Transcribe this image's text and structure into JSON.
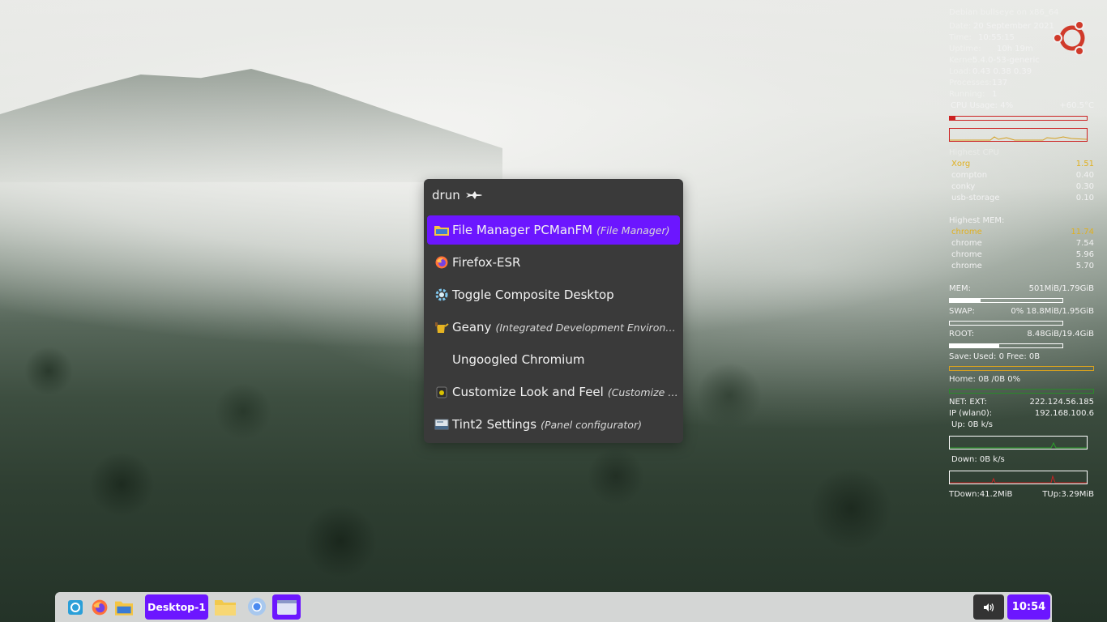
{
  "conky": {
    "header": "Debian bullseye on x86_64",
    "sys": [
      {
        "label": "Date:",
        "value": "20 September 2021"
      },
      {
        "label": "Time:",
        "value": "10:55:15"
      },
      {
        "label": "Uptime:",
        "value": "10h 19m"
      },
      {
        "label": "Kernel:",
        "value": "5.4.0-53-generic"
      },
      {
        "label": "Load:",
        "value": "0.43 0.38 0.39"
      },
      {
        "label": "Processes:",
        "value": "137"
      },
      {
        "label": "Running:",
        "value": "1"
      }
    ],
    "cpu": {
      "label": "CPU Usage: 4%",
      "temp": "+60.5°C",
      "usage": 0.04
    },
    "highest_cpu": {
      "title": "Highest CPU",
      "rows": [
        {
          "name": "Xorg",
          "value": "1.51"
        },
        {
          "name": "compton",
          "value": "0.40"
        },
        {
          "name": "conky",
          "value": "0.30"
        },
        {
          "name": "usb-storage",
          "value": "0.10"
        }
      ]
    },
    "highest_mem": {
      "title": "Highest MEM:",
      "rows": [
        {
          "name": "chrome",
          "value": "11.74"
        },
        {
          "name": "chrome",
          "value": "7.54"
        },
        {
          "name": "chrome",
          "value": "5.96"
        },
        {
          "name": "chrome",
          "value": "5.70"
        }
      ]
    },
    "mem": {
      "label": "MEM:",
      "value": "501MiB/1.79GiB",
      "fill": 0.27
    },
    "swap": {
      "label": "SWAP:",
      "value": "0% 18.8MiB/1.95GiB",
      "fill": 0.0
    },
    "root": {
      "label": "ROOT:",
      "value": "8.48GiB/19.4GiB",
      "fill": 0.44
    },
    "save": {
      "label": "Save:",
      "value": "Used: 0 Free: 0B"
    },
    "home": {
      "label": "Home: 0B  /0B   0%"
    },
    "net": {
      "ext_label": "NET: EXT:",
      "ext_value": "222.124.56.185",
      "ip_label": "IP (wlan0):",
      "ip_value": "192.168.100.6",
      "up": "Up: 0B   k/s",
      "down": "Down: 0B  k/s",
      "tdown": "TDown:41.2MiB",
      "tup": "TUp:3.29MiB"
    },
    "colors": {
      "cpu_bar": "#cc2222",
      "save_bar": "#d4a020",
      "home_bar": "#2a8a2a",
      "highlight": "#e0b020"
    }
  },
  "launcher": {
    "prompt": "drun",
    "prompt_icon": "rocket-icon",
    "items": [
      {
        "label": "File Manager PCManFM",
        "sub": "(File Manager)",
        "icon": "folder-icon",
        "selected": true
      },
      {
        "label": "Firefox-ESR",
        "sub": "",
        "icon": "firefox-icon"
      },
      {
        "label": "Toggle Composite Desktop",
        "sub": "",
        "icon": "gear-icon"
      },
      {
        "label": "Geany",
        "sub": "(Integrated Development Environment)",
        "icon": "geany-icon"
      },
      {
        "label": "Ungoogled Chromium",
        "sub": "",
        "icon": ""
      },
      {
        "label": "Customize Look and Feel",
        "sub": "(Customize L…",
        "icon": "theme-icon"
      },
      {
        "label": "Tint2 Settings",
        "sub": "(Panel configurator)",
        "icon": "tint2-icon"
      }
    ],
    "accent": "#6c16ff"
  },
  "taskbar": {
    "desktop_label": "Desktop-1",
    "clock": "10:54",
    "launchers": [
      "show-desktop-icon",
      "firefox-icon",
      "file-manager-icon"
    ],
    "tasks": [
      "folder-icon",
      "chromium-icon",
      "window-icon"
    ],
    "volume_icon": "speaker-icon"
  }
}
